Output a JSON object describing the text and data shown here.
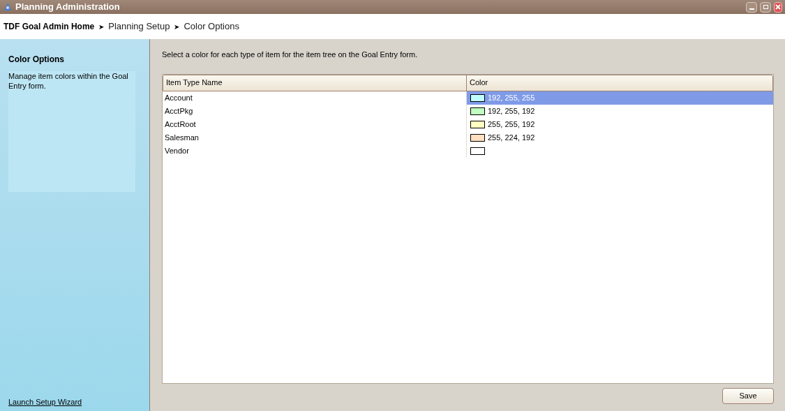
{
  "window": {
    "title": "Planning Administration"
  },
  "breadcrumb": [
    {
      "label": "TDF Goal Admin Home"
    },
    {
      "label": "Planning Setup"
    },
    {
      "label": "Color Options"
    }
  ],
  "breadcrumb_separator": "➤",
  "sidebar": {
    "title": "Color Options",
    "description": "Manage item colors within the Goal Entry form.",
    "link": "Launch Setup Wizard"
  },
  "instructions": "Select a color for each type of item for the item tree on the Goal Entry form.",
  "table": {
    "columns": [
      "Item Type Name",
      "Color"
    ],
    "rows": [
      {
        "name": "Account",
        "color": "#c0ffff",
        "value": "192, 255, 255",
        "selected": true
      },
      {
        "name": "AcctPkg",
        "color": "#c0ffc0",
        "value": "192, 255, 192",
        "selected": false
      },
      {
        "name": "AcctRoot",
        "color": "#ffffc0",
        "value": "255, 255, 192",
        "selected": false
      },
      {
        "name": "Salesman",
        "color": "#ffe0c0",
        "value": "255, 224, 192",
        "selected": false
      },
      {
        "name": "Vendor",
        "color": "#ffffff",
        "selected": false
      }
    ]
  },
  "buttons": [
    "Save"
  ]
}
